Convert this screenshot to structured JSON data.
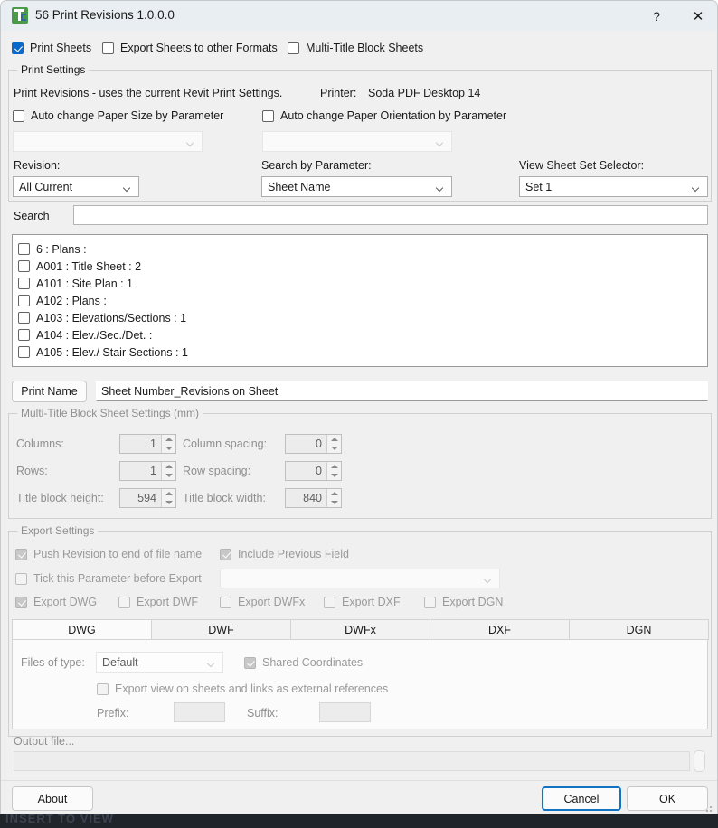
{
  "window": {
    "title": "56 Print Revisions 1.0.0.0",
    "icon": "app-icon",
    "help_label": "?",
    "close_label": "✕",
    "accent_color": "#0a69c8",
    "background_color": "#f0f0f0",
    "titlebar_color": "#e8eef1"
  },
  "top_options": [
    {
      "label": "Print Sheets",
      "checked": true,
      "enabled": true
    },
    {
      "label": "Export Sheets to other Formats",
      "checked": false,
      "enabled": true
    },
    {
      "label": "Multi-Title Block Sheets",
      "checked": false,
      "enabled": true
    }
  ],
  "print_settings": {
    "group_title": "Print Settings",
    "description": "Print Revisions - uses the current Revit Print Settings.",
    "printer_label": "Printer:",
    "printer_value": "Soda PDF Desktop 14",
    "auto_paper_size": {
      "label": "Auto change Paper Size by Parameter",
      "checked": false
    },
    "auto_paper_orientation": {
      "label": "Auto change Paper Orientation by Parameter",
      "checked": false
    },
    "paper_size_combo": {
      "value": "",
      "enabled": false
    },
    "paper_orientation_combo": {
      "value": "",
      "enabled": false
    },
    "revision": {
      "label": "Revision:",
      "value": "All Current"
    },
    "search_by_parameter": {
      "label": "Search by Parameter:",
      "value": "Sheet Name"
    },
    "view_sheet_set_selector": {
      "label": "View Sheet Set Selector:",
      "value": "Set 1"
    },
    "search": {
      "label": "Search",
      "value": "",
      "placeholder": ""
    }
  },
  "sheet_list": [
    {
      "label": "6 : Plans :",
      "checked": false
    },
    {
      "label": "A001 : Title Sheet : 2",
      "checked": false
    },
    {
      "label": "A101 : Site Plan : 1",
      "checked": false
    },
    {
      "label": "A102 : Plans :",
      "checked": false
    },
    {
      "label": "A103 : Elevations/Sections : 1",
      "checked": false
    },
    {
      "label": "A104 : Elev./Sec./Det. :",
      "checked": false
    },
    {
      "label": "A105 : Elev./ Stair Sections : 1",
      "checked": false
    }
  ],
  "print_name": {
    "button_label": "Print Name",
    "value": "Sheet Number_Revisions on Sheet"
  },
  "multi_title_block": {
    "group_title": "Multi-Title Block Sheet Settings (mm)",
    "columns": {
      "label": "Columns:",
      "value": "1"
    },
    "column_spacing": {
      "label": "Column spacing:",
      "value": "0"
    },
    "rows": {
      "label": "Rows:",
      "value": "1"
    },
    "row_spacing": {
      "label": "Row spacing:",
      "value": "0"
    },
    "title_block_height": {
      "label": "Title block height:",
      "value": "594"
    },
    "title_block_width": {
      "label": "Title block width:",
      "value": "840"
    }
  },
  "export_settings": {
    "group_title": "Export Settings",
    "push_revision": {
      "label": "Push Revision to end of file name",
      "checked": true,
      "enabled": false
    },
    "include_previous_field": {
      "label": "Include Previous Field",
      "checked": true,
      "enabled": false
    },
    "tick_parameter": {
      "label": "Tick this Parameter before Export",
      "checked": false,
      "enabled": false
    },
    "parameter_combo": {
      "value": "",
      "enabled": false
    },
    "formats": [
      {
        "label": "Export DWG",
        "checked": true,
        "enabled": false
      },
      {
        "label": "Export DWF",
        "checked": false,
        "enabled": false
      },
      {
        "label": "Export DWFx",
        "checked": false,
        "enabled": false
      },
      {
        "label": "Export DXF",
        "checked": false,
        "enabled": false
      },
      {
        "label": "Export DGN",
        "checked": false,
        "enabled": false
      }
    ],
    "tabs": [
      {
        "label": "DWG",
        "active": true
      },
      {
        "label": "DWF",
        "active": false
      },
      {
        "label": "DWFx",
        "active": false
      },
      {
        "label": "DXF",
        "active": false
      },
      {
        "label": "DGN",
        "active": false
      }
    ],
    "dwg_panel": {
      "files_of_type_label": "Files of type:",
      "files_of_type_value": "Default",
      "shared_coordinates": {
        "label": "Shared Coordinates",
        "checked": true,
        "enabled": false
      },
      "export_views": {
        "label": "Export view on sheets and links as external references",
        "checked": false,
        "enabled": false
      },
      "prefix_label": "Prefix:",
      "prefix_value": "",
      "suffix_label": "Suffix:",
      "suffix_value": ""
    }
  },
  "output": {
    "label": "Output file...",
    "value": "",
    "browse_label": ""
  },
  "footer": {
    "about_label": "About",
    "cancel_label": "Cancel",
    "ok_label": "OK"
  },
  "desktop": {
    "ghost_text": "INSERT TO VIEW"
  }
}
